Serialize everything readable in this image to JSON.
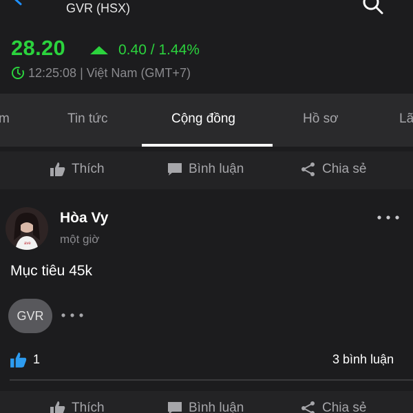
{
  "header": {
    "title": "GVR (HSX)"
  },
  "quote": {
    "price": "28.20",
    "change": "0.40 / 1.44%",
    "timestamp": "12:25:08 | Việt Nam (GMT+7)",
    "color_up": "#2bd33d"
  },
  "tabs": [
    {
      "label": "m"
    },
    {
      "label": "Tin tức"
    },
    {
      "label": "Cộng đồng",
      "active": true
    },
    {
      "label": "Hồ sơ"
    },
    {
      "label": "Lã"
    }
  ],
  "actions": {
    "like": "Thích",
    "comment": "Bình luận",
    "share": "Chia sẻ"
  },
  "post": {
    "author": "Hòa Vy",
    "time": "một giờ",
    "content": "Mục tiêu 45k",
    "tag": "GVR",
    "likes": "1",
    "comments": "3 bình luận"
  },
  "icons": [
    "back-icon",
    "search-icon",
    "up-triangle-icon",
    "clock-icon",
    "thumbs-up-icon",
    "comment-icon",
    "share-icon",
    "more-icon"
  ]
}
